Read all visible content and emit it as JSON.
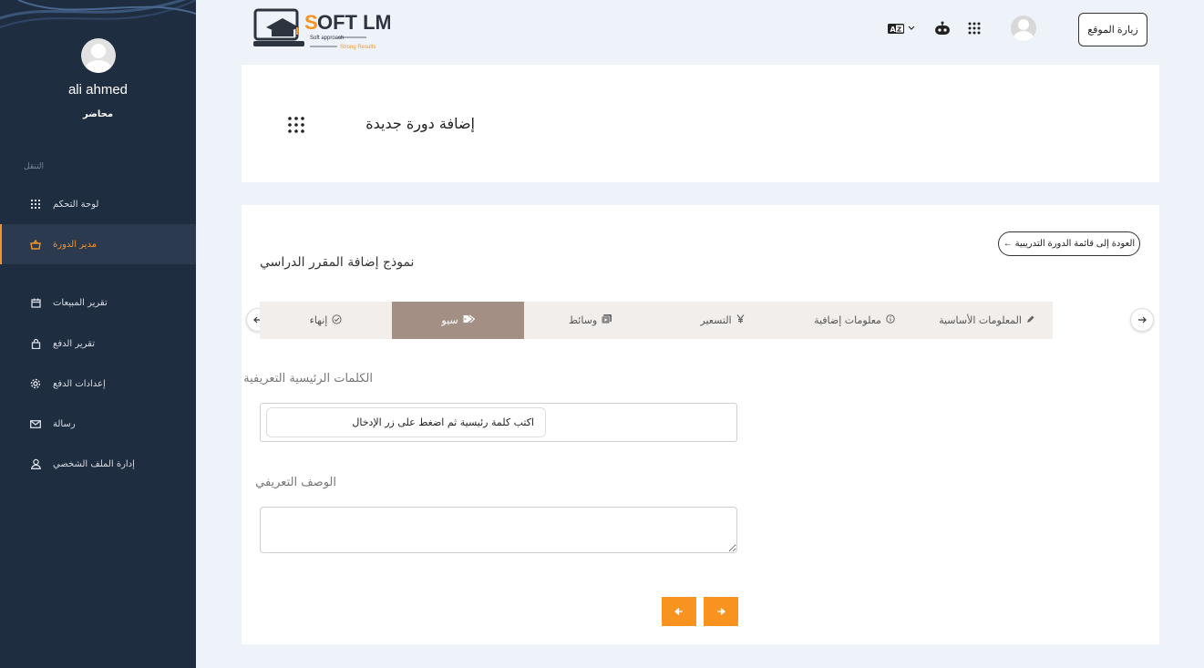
{
  "sidebar": {
    "user_name": "ali ahmed",
    "user_role": "محاضر",
    "nav_heading": "التنقل",
    "items": [
      {
        "label": "لوحة التحكم",
        "icon": "grid-icon"
      },
      {
        "label": "مدير الدورة",
        "icon": "basket-icon",
        "active": true
      },
      {
        "label": "تقرير المبيعات",
        "icon": "calendar-icon"
      },
      {
        "label": "تقرير الدفع",
        "icon": "bag-icon"
      },
      {
        "label": "إعدادات الدفع",
        "icon": "settings-icon"
      },
      {
        "label": "رسالة",
        "icon": "mail-icon"
      },
      {
        "label": "إدارة الملف الشخصي",
        "icon": "user-icon"
      }
    ]
  },
  "header": {
    "logo_text": "SOFT LMS",
    "logo_tagline_1": "Soft approach",
    "logo_tagline_2": "Strong Results",
    "visit_site_label": "زيارة الموقع"
  },
  "page": {
    "title": "إضافة دورة جديدة"
  },
  "form": {
    "back_label": "العودة إلى قائمة الدورة التدريبية ←",
    "title": "نموذج إضافة المقرر الدراسي",
    "tabs": [
      {
        "label": "المعلومات الأساسية",
        "icon": "pen-icon"
      },
      {
        "label": "معلومات إضافية",
        "icon": "info-icon"
      },
      {
        "label": "التسعير",
        "icon": "yen-icon"
      },
      {
        "label": "وسائط",
        "icon": "media-icon"
      },
      {
        "label": "سيو",
        "icon": "tags-icon",
        "active": true
      },
      {
        "label": "إنهاء",
        "icon": "check-circle-icon"
      }
    ],
    "keywords_label": "الكلمات الرئيسية التعريفية",
    "keywords_placeholder": "اكتب كلمة رئيسية ثم اضغط على زر الإدخال",
    "description_label": "الوصف التعريفي",
    "description_value": ""
  },
  "colors": {
    "sidebar_bg": "#1f2d40",
    "accent": "#f7931e",
    "active_tab": "#a38f84"
  }
}
